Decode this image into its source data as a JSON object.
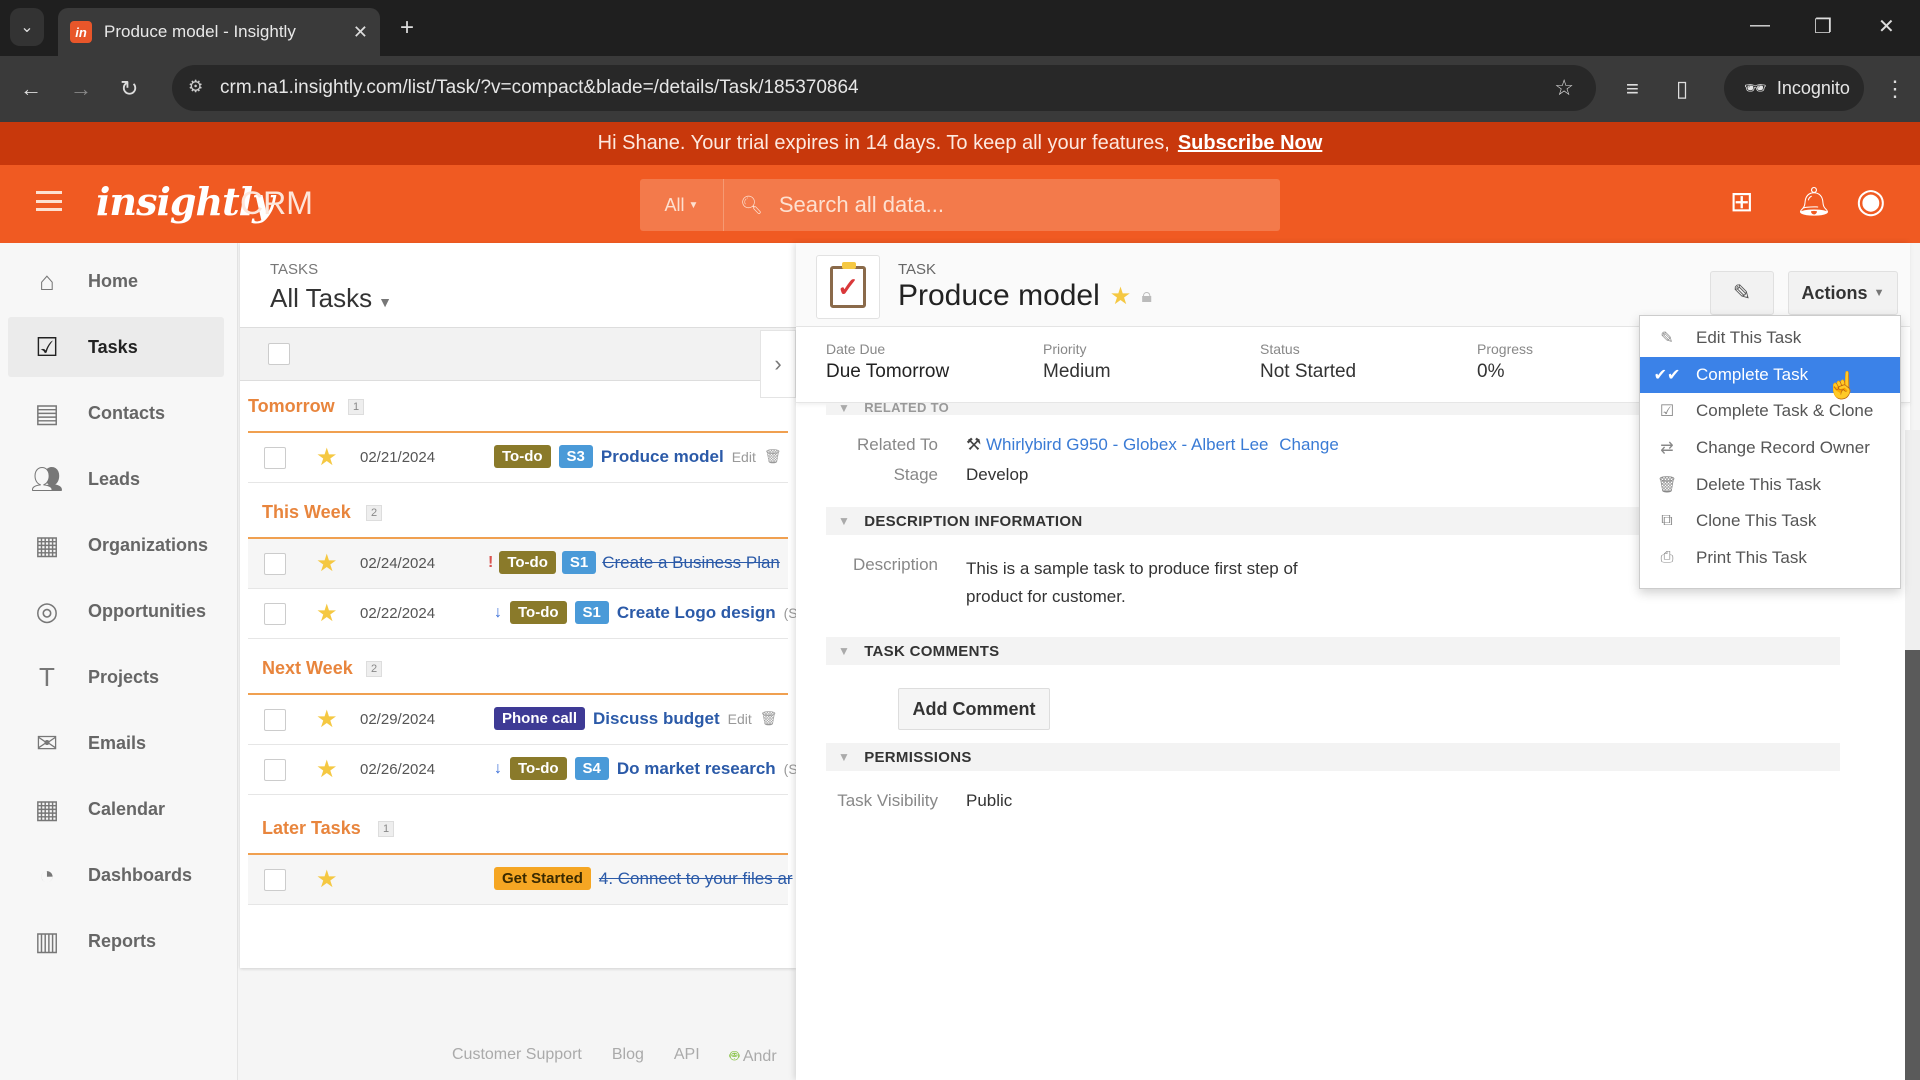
{
  "browser": {
    "tab_title": "Produce model - Insightly",
    "url": "crm.na1.insightly.com/list/Task/?v=compact&blade=/details/Task/185370864",
    "incognito_label": "Incognito"
  },
  "banner": {
    "message": "Hi Shane. Your trial expires in 14 days. To keep all your features,",
    "link": "Subscribe Now"
  },
  "header": {
    "logo": "insightly",
    "product": "CRM",
    "search_scope": "All",
    "search_placeholder": "Search all data..."
  },
  "sidebar": {
    "items": [
      {
        "label": "Home",
        "icon": "home-icon"
      },
      {
        "label": "Tasks",
        "icon": "tasks-icon",
        "active": true
      },
      {
        "label": "Contacts",
        "icon": "contacts-icon"
      },
      {
        "label": "Leads",
        "icon": "leads-icon"
      },
      {
        "label": "Organizations",
        "icon": "organizations-icon"
      },
      {
        "label": "Opportunities",
        "icon": "opportunities-icon"
      },
      {
        "label": "Projects",
        "icon": "projects-icon"
      },
      {
        "label": "Emails",
        "icon": "emails-icon"
      },
      {
        "label": "Calendar",
        "icon": "calendar-icon"
      },
      {
        "label": "Dashboards",
        "icon": "dashboards-icon"
      },
      {
        "label": "Reports",
        "icon": "reports-icon"
      }
    ]
  },
  "list": {
    "kicker": "TASKS",
    "title": "All Tasks",
    "groups": [
      {
        "name": "Tomorrow",
        "count": "1"
      },
      {
        "name": "This Week",
        "count": "2"
      },
      {
        "name": "Next Week",
        "count": "2"
      },
      {
        "name": "Later Tasks",
        "count": "1"
      }
    ],
    "rows": [
      {
        "date": "02/21/2024",
        "type": "To-do",
        "stage": "S3",
        "name": "Produce model",
        "edit": "Edit"
      },
      {
        "date": "02/24/2024",
        "type": "To-do",
        "stage": "S1",
        "name": "Create a Business Plan",
        "priority": "high"
      },
      {
        "date": "02/22/2024",
        "type": "To-do",
        "stage": "S1",
        "name": "Create Logo design",
        "priority": "low",
        "suffix": "(S"
      },
      {
        "date": "02/29/2024",
        "type": "Phone call",
        "name": "Discuss budget",
        "edit": "Edit"
      },
      {
        "date": "02/26/2024",
        "type": "To-do",
        "stage": "S4",
        "name": "Do market research",
        "priority": "low",
        "suffix": "(S"
      },
      {
        "date": "",
        "type": "Get Started",
        "name": "4. Connect to your files ar"
      }
    ]
  },
  "footer": {
    "links": [
      "Customer Support",
      "Blog",
      "API",
      "Andr"
    ]
  },
  "detail": {
    "kicker": "TASK",
    "title": "Produce model",
    "actions_label": "Actions",
    "fields": [
      {
        "label": "Date Due",
        "value": "Due Tomorrow"
      },
      {
        "label": "Priority",
        "value": "Medium"
      },
      {
        "label": "Status",
        "value": "Not Started"
      },
      {
        "label": "Progress",
        "value": "0%"
      }
    ],
    "related_heading": "RELATED TO",
    "related_to_label": "Related To",
    "related_to_value": "Whirlybird G950 - Globex - Albert Lee",
    "change_link": "Change",
    "stage_label": "Stage",
    "stage_value": "Develop",
    "description_heading": "DESCRIPTION INFORMATION",
    "description_label": "Description",
    "description_line1": "This is a sample task to produce first step of",
    "description_line2": "product for customer.",
    "comments_heading": "TASK COMMENTS",
    "add_comment": "Add Comment",
    "permissions_heading": "PERMISSIONS",
    "visibility_label": "Task Visibility",
    "visibility_value": "Public"
  },
  "actions_menu": {
    "items": [
      {
        "label": "Edit This Task",
        "icon": "pencil-icon"
      },
      {
        "label": "Complete Task",
        "icon": "double-check-icon",
        "highlighted": true
      },
      {
        "label": "Complete Task & Clone",
        "icon": "complete-clone-icon"
      },
      {
        "label": "Change Record Owner",
        "icon": "change-owner-icon"
      },
      {
        "label": "Delete This Task",
        "icon": "trash-icon"
      },
      {
        "label": "Clone This Task",
        "icon": "clone-icon"
      },
      {
        "label": "Print This Task",
        "icon": "printer-icon"
      }
    ]
  },
  "colors": {
    "brand": "#f05a22",
    "banner": "#c8380c",
    "highlight": "#3b82e8",
    "todo_badge": "#8a7a2a",
    "stage_badge": "#4a9ad8",
    "phone_badge": "#3e3a95",
    "get_started_badge": "#f5a623"
  }
}
